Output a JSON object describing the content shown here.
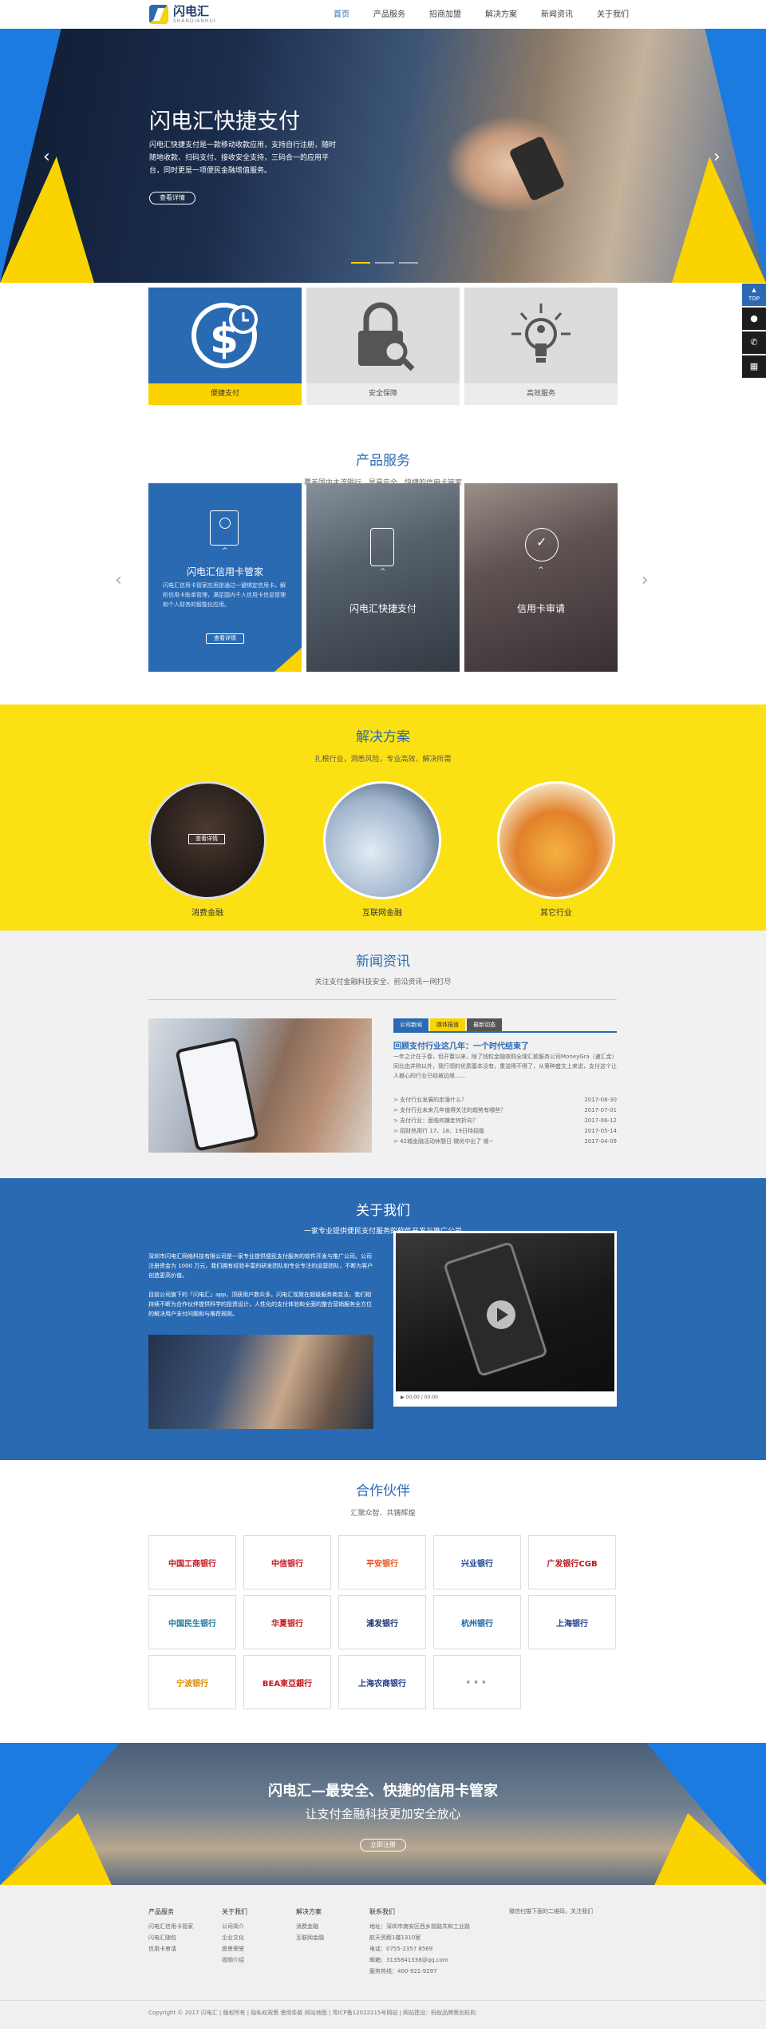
{
  "header": {
    "logo_cn": "闪电汇",
    "logo_en": "SHANDIANHUI",
    "nav": [
      "首页",
      "产品服务",
      "招商加盟",
      "解决方案",
      "新闻资讯",
      "关于我们"
    ]
  },
  "banner": {
    "title": "闪电汇快捷支付",
    "desc": "闪电汇快捷支付是一款移动收款应用，支持自行注册，随时随地收款、扫码支付、接收安全支持，三码合一的应用平台，同时更是一项便民金融增值服务。",
    "button": "查看详情"
  },
  "side": {
    "top": "TOP"
  },
  "features": [
    "便捷支付",
    "安全保障",
    "高效服务"
  ],
  "products": {
    "title": "产品服务",
    "subtitle": "覆盖国内主流银行，是最安全、快捷的信用卡管家",
    "items": [
      {
        "name": "闪电汇信用卡管家",
        "desc": "闪电汇信用卡管家应用是通过一键绑定信用卡，解析信用卡账单管理，满足国内千人信用卡信息管理和个人财务的智能化应用。",
        "button": "查看详情"
      },
      {
        "name": "闪电汇快捷支付"
      },
      {
        "name": "信用卡审请"
      }
    ]
  },
  "solutions": {
    "title": "解决方案",
    "subtitle": "扎根行业，洞悉风险，专业高效，解决所需",
    "button": "查看详情",
    "items": [
      "消费金融",
      "互联网金融",
      "其它行业"
    ]
  },
  "news": {
    "title": "新闻资讯",
    "subtitle": "关注支付金融科技安全、前沿资讯一网打尽",
    "tabs": [
      "公司新闻",
      "媒体报道",
      "最新动态"
    ],
    "headline": "回顾支付行业这几年：一个时代结束了",
    "summary": "一年之计在于春，但开春以来，除了钱粒金融收购全球汇款服务公司MoneyGra（速汇金）同比由并购以外，我行领的优质基本没有，重溢得不得了，从第种盛文上来说，支付这个让人撼心的行业已经被边缘……",
    "list": [
      {
        "title": "> 支付行业发展的走强什么？",
        "date": "2017-08-30"
      },
      {
        "title": "> 支付行业未来几年值得关注的趋势有哪些？",
        "date": "2017-07-01"
      },
      {
        "title": "> 支付行业：面临何嫌走何折向？",
        "date": "2017-06-12"
      },
      {
        "title": "> 招财热用行 17、18、19日特招版",
        "date": "2017-05-14"
      },
      {
        "title": "> 42城金融活动休憩日 微优中出了 锡~",
        "date": "2017-04-09"
      }
    ]
  },
  "about": {
    "title": "关于我们",
    "subtitle": "一家专业提供便民支付服务的软件开发与推广公司",
    "p1": "深圳市闪电汇网络科技有限公司是一家专业提供便民支付服务的软件开发与推广公司。公司注册资金为 1000 万元，我们拥有经验丰富的研发团队和专业专注的运营团队，不断为客户创造更高价值。",
    "p2": "目前公司旗下的「闪电汇」app，顶获用户数众多。闪电汇现致在超级服务商变法，我们相持续不断为合作伙伴提供科学的投资设计，人性化的支付体验和全面的整合营销服务全方位的解决用户支付问题和与推荐规则。",
    "video_time": "00:00 / 00:00"
  },
  "partners": {
    "title": "合作伙伴",
    "subtitle": "汇聚众智、共铸辉煌",
    "banks": [
      {
        "name": "中国工商银行",
        "color": "#c7161e"
      },
      {
        "name": "中信银行",
        "color": "#c7161e"
      },
      {
        "name": "平安银行",
        "color": "#e8541e"
      },
      {
        "name": "兴业银行",
        "color": "#14408e"
      },
      {
        "name": "广发银行CGB",
        "color": "#b8151c"
      },
      {
        "name": "中国民生银行",
        "color": "#1b7b9e"
      },
      {
        "name": "华夏银行",
        "color": "#c8161d"
      },
      {
        "name": "浦发银行",
        "color": "#1b2e6e"
      },
      {
        "name": "杭州银行",
        "color": "#1166a8"
      },
      {
        "name": "上海银行",
        "color": "#1d3f8b"
      },
      {
        "name": "宁波银行",
        "color": "#e08a00"
      },
      {
        "name": "BEA東亞銀行",
        "color": "#c7161e"
      },
      {
        "name": "上海农商银行",
        "color": "#1b3b85"
      },
      {
        "name": "···",
        "color": "#999999"
      }
    ]
  },
  "cta": {
    "title": "闪电汇—最安全、快捷的信用卡管家",
    "subtitle": "让支付金融科技更加安全放心",
    "button": "立即注册"
  },
  "footer": {
    "cols": [
      {
        "title": "产品服务",
        "items": [
          "闪电汇信用卡管家",
          "闪电汇随包",
          "信用卡审请"
        ]
      },
      {
        "title": "关于我们",
        "items": [
          "公司简介",
          "企业文化",
          "愿景荣誉",
          "视频介绍"
        ]
      },
      {
        "title": "解决方案",
        "items": [
          "消费金融",
          "互联网金融"
        ]
      },
      {
        "title": "联系我们",
        "items": [
          "地址：深圳市南安区西乡前路共和工业路",
          "航天资醇1楼1310室",
          "电话：0755-2357 8569",
          "邮箱：3135841338@qq.com",
          "服务热线：400-921-9297"
        ]
      }
    ],
    "follow": "微信扫描下面的二维码，关注我们",
    "copyright": "Copyright © 2017 闪电汇    |    版权所有    |    隐私权政策  使用条款  网站地图    |    粤ICP备12022215号网站    |    网站建设：蚂蚁品牌策划机构"
  }
}
